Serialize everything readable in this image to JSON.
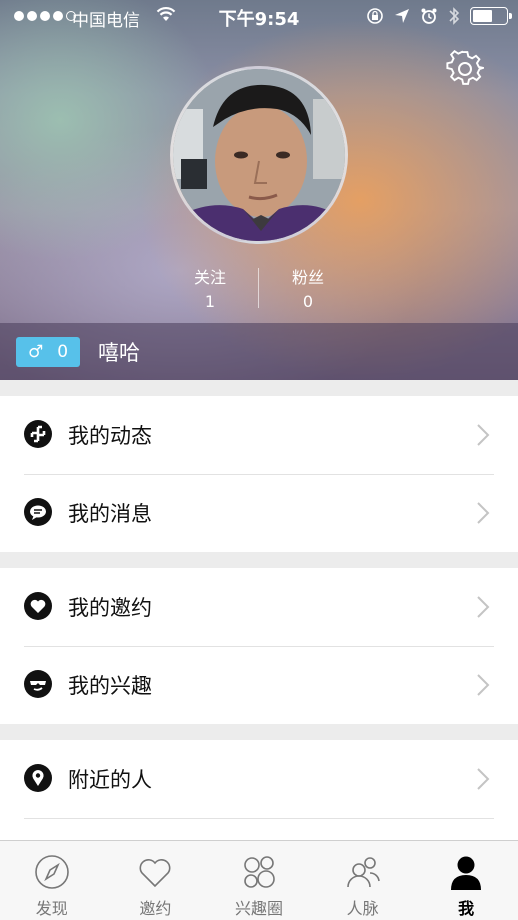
{
  "status_bar": {
    "carrier": "中国电信",
    "time": "下午9:54"
  },
  "profile": {
    "following_label": "关注",
    "following_count": "1",
    "followers_label": "粉丝",
    "followers_count": "0",
    "gender_symbol": "♂",
    "gender_count": "0",
    "username": "嘻哈"
  },
  "menu_groups": [
    [
      {
        "label": "我的动态",
        "icon": "feed-icon"
      },
      {
        "label": "我的消息",
        "icon": "message-icon"
      }
    ],
    [
      {
        "label": "我的邀约",
        "icon": "heart-icon"
      },
      {
        "label": "我的兴趣",
        "icon": "sunglasses-icon"
      }
    ],
    [
      {
        "label": "附近的人",
        "icon": "location-pin-icon"
      }
    ]
  ],
  "tabs": [
    {
      "label": "发现",
      "icon": "compass-icon"
    },
    {
      "label": "邀约",
      "icon": "heart-outline-icon"
    },
    {
      "label": "兴趣圈",
      "icon": "circles-icon"
    },
    {
      "label": "人脉",
      "icon": "people-icon"
    },
    {
      "label": "我",
      "icon": "person-icon",
      "active": true
    }
  ],
  "colors": {
    "gender_badge": "#57c1ea",
    "tab_active": "#000000",
    "tab_inactive": "#777777"
  }
}
